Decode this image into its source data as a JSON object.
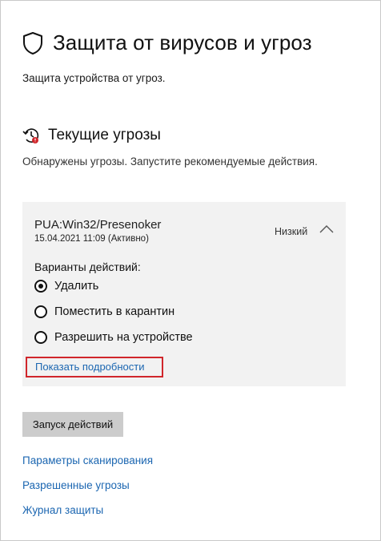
{
  "page": {
    "title": "Защита от вирусов и угроз",
    "subtitle": "Защита устройства от угроз."
  },
  "current_threats": {
    "title": "Текущие угрозы",
    "description": "Обнаружены угрозы. Запустите рекомендуемые действия."
  },
  "threat": {
    "name": "PUA:Win32/Presenoker",
    "date": "15.04.2021 11:09 (Активно)",
    "severity": "Низкий",
    "actions_label": "Варианты действий:",
    "options": [
      {
        "label": "Удалить",
        "selected": true
      },
      {
        "label": "Поместить в карантин",
        "selected": false
      },
      {
        "label": "Разрешить на устройстве",
        "selected": false
      }
    ],
    "details_link": "Показать подробности"
  },
  "run_button": "Запуск действий",
  "links": {
    "scan_options": "Параметры сканирования",
    "allowed_threats": "Разрешенные угрозы",
    "protection_history": "Журнал защиты"
  },
  "colors": {
    "link": "#1b66b1",
    "card_background": "#f2f2f2",
    "highlight_border": "#d0262b",
    "button_background": "#cccccc"
  },
  "icons": {
    "header": "shield-icon",
    "section": "threat-history-icon",
    "expander": "chevron-up-icon"
  }
}
